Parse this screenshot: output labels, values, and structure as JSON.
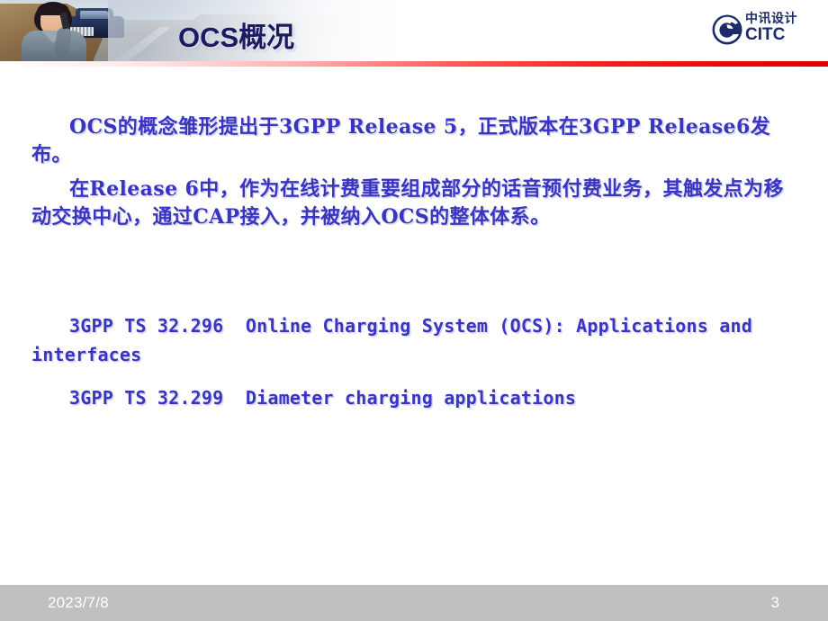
{
  "header": {
    "title": "OCS概况",
    "banner_image_alt": "woman-with-mobile-phone-and-suv-on-desert-road",
    "logo": {
      "mark": "swirl-circle-emblem",
      "cn_name": "中讯设计",
      "en_name": "CITC",
      "color": "#1d2a6b"
    },
    "rule_color": "#e00000"
  },
  "body": {
    "paragraphs": [
      "OCS的概念雏形提出于3GPP Release 5，正式版本在3GPP Release6发布。",
      "在Release 6中，作为在线计费重要组成部分的话音预付费业务，其触发点为移动交换中心，通过CAP接入，并被纳入OCS的整体体系。"
    ],
    "references": [
      "3GPP TS 32.296  Online Charging System (OCS): Applications and interfaces",
      "3GPP TS 32.299  Diameter charging applications"
    ],
    "text_color": "#3a35c0"
  },
  "footer": {
    "date": "2023/7/8",
    "page_number": "3",
    "background_color": "#c0c0c0",
    "text_color": "#ffffff"
  }
}
